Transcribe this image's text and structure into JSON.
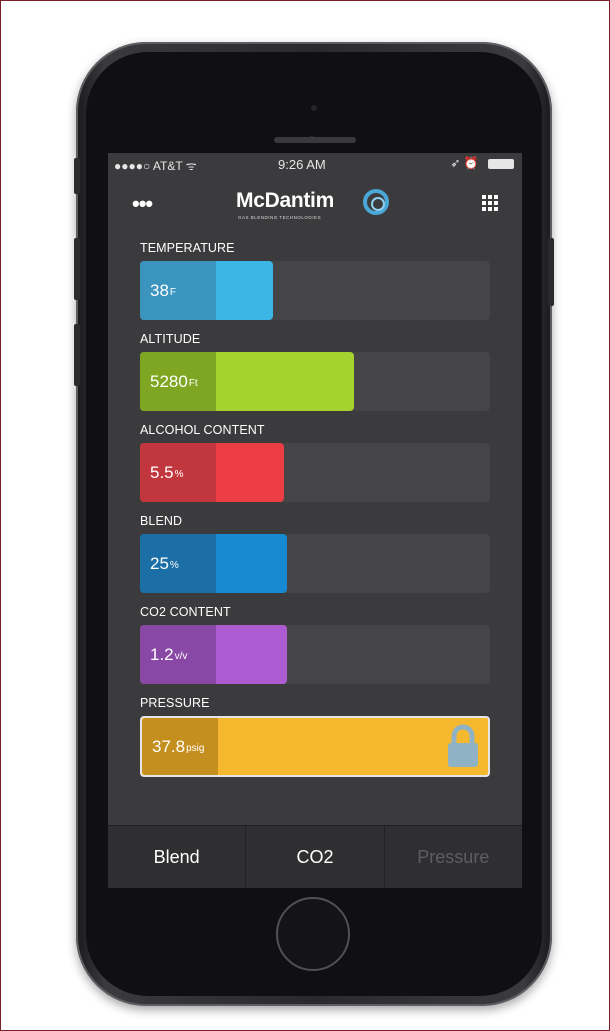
{
  "status_bar": {
    "carrier": "●●●●○ AT&T ᯤ",
    "time": "9:26 AM",
    "right_indicators": "➶ ⏰"
  },
  "header": {
    "menu_icon": "more-dots-icon",
    "logo_name": "McDantim",
    "logo_tagline": "GAS BLENDING TECHNOLOGIES",
    "grid_icon": "grid-icon"
  },
  "gauges": [
    {
      "label": "TEMPERATURE",
      "value": "38",
      "unit": "F",
      "fill_fraction": 0.38,
      "colors": {
        "value_bg": "#3a94bd",
        "fill": "#3bb6e4"
      }
    },
    {
      "label": "ALTITUDE",
      "value": "5280",
      "unit": "Ft",
      "fill_fraction": 0.61,
      "colors": {
        "value_bg": "#7fa622",
        "fill": "#a6d22f"
      }
    },
    {
      "label": "ALCOHOL CONTENT",
      "value": "5.5",
      "unit": "%",
      "fill_fraction": 0.41,
      "colors": {
        "value_bg": "#c2363e",
        "fill": "#ec3d45"
      }
    },
    {
      "label": "BLEND",
      "value": "25",
      "unit": "%",
      "fill_fraction": 0.42,
      "colors": {
        "value_bg": "#1c6ea6",
        "fill": "#1788d2"
      }
    },
    {
      "label": "CO2 CONTENT",
      "value": "1.2",
      "unit": "v/v",
      "fill_fraction": 0.42,
      "colors": {
        "value_bg": "#8a48a6",
        "fill": "#ad5bd0"
      }
    },
    {
      "label": "PRESSURE",
      "value": "37.8",
      "unit": "psig",
      "fill_fraction": 1.0,
      "locked": true,
      "colors": {
        "value_bg": "#c48f1e",
        "fill": "#f5b82e"
      }
    }
  ],
  "tabs": [
    {
      "label": "Blend",
      "active": true
    },
    {
      "label": "CO2",
      "active": true
    },
    {
      "label": "Pressure",
      "active": false
    }
  ]
}
